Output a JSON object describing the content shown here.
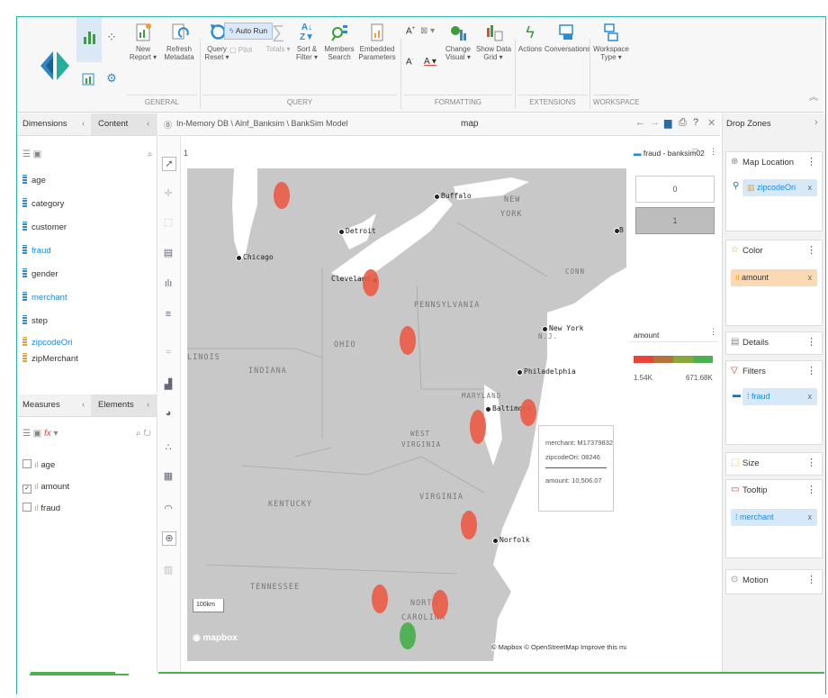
{
  "ribbon": {
    "buttons": {
      "new_report": "New\nReport ▾",
      "refresh_metadata": "Refresh\nMetadata",
      "query_reset": "Query\nReset ▾",
      "auto_run": "Auto Run",
      "pilot": "Pilot",
      "totals": "Totals ▾",
      "sort_filter": "Sort &\nFilter ▾",
      "members_search": "Members\nSearch",
      "embedded_parameters": "Embedded\nParameters",
      "change_visual": "Change\nVisual ▾",
      "show_data_grid": "Show Data\nGrid ▾",
      "actions": "Actions",
      "conversations": "Conversations",
      "workspace_type": "Workspace\nType ▾"
    },
    "groups": {
      "general": "GENERAL",
      "query": "QUERY",
      "formatting": "FORMATTING",
      "extensions": "EXTENSIONS",
      "workspace": "WORKSPACE"
    }
  },
  "left_panel": {
    "tab_dimensions": "Dimensions",
    "tab_content": "Content",
    "dimensions": [
      "age",
      "category",
      "customer",
      "fraud",
      "gender",
      "merchant",
      "step",
      "zipcodeOri",
      "zipMerchant"
    ],
    "tab_measures": "Measures",
    "tab_elements": "Elements",
    "measures": [
      {
        "label": "age",
        "checked": false
      },
      {
        "label": "amount",
        "checked": true
      },
      {
        "label": "fraud",
        "checked": false
      }
    ]
  },
  "center": {
    "breadcrumb": "In-Memory DB \\ Alnf_Banksim \\ BankSim Model",
    "title": "map",
    "row_number": "1"
  },
  "map": {
    "cities": [
      "Buffalo",
      "Detroit",
      "Chicago",
      "Cleveland",
      "New York",
      "Philadelphia",
      "Baltimore",
      "Norfolk",
      "B"
    ],
    "states": [
      "NEW",
      "YORK",
      "PENNSYLVANIA",
      "OHIO",
      "INDIANA",
      "LINOIS",
      "MARYLAND",
      "WEST",
      "VIRGINIA",
      "VIRGINIA",
      "KENTUCKY",
      "TENNESSEE",
      "NORTH",
      "CAROLINA",
      "CONN",
      "N.J."
    ],
    "scale": "100km",
    "attribution": "© Mapbox © OpenStreetMap",
    "improve_link": "Improve this map",
    "logo": "mapbox",
    "tooltip": {
      "merchant": "merchant: M17379832",
      "zipcode": "zipcodeOri: 08246",
      "amount": "amount: 10,506.07"
    }
  },
  "legend": {
    "fraud_title": "fraud - banksim02",
    "fraud_values": [
      "0",
      "1"
    ],
    "amount_title": "amount",
    "amount_min": "1.54K",
    "amount_max": "671.68K",
    "colors": [
      "#e8443a",
      "#b8713a",
      "#8aa83a",
      "#4caf50"
    ]
  },
  "drop_zones": {
    "title": "Drop Zones",
    "map_location": {
      "label": "Map Location",
      "field": "zipcodeOri"
    },
    "color": {
      "label": "Color",
      "field": "amount"
    },
    "details": {
      "label": "Details"
    },
    "filters": {
      "label": "Filters",
      "field": "fraud"
    },
    "size": {
      "label": "Size"
    },
    "tooltip": {
      "label": "Tooltip",
      "field": "merchant"
    },
    "motion": {
      "label": "Motion"
    }
  }
}
